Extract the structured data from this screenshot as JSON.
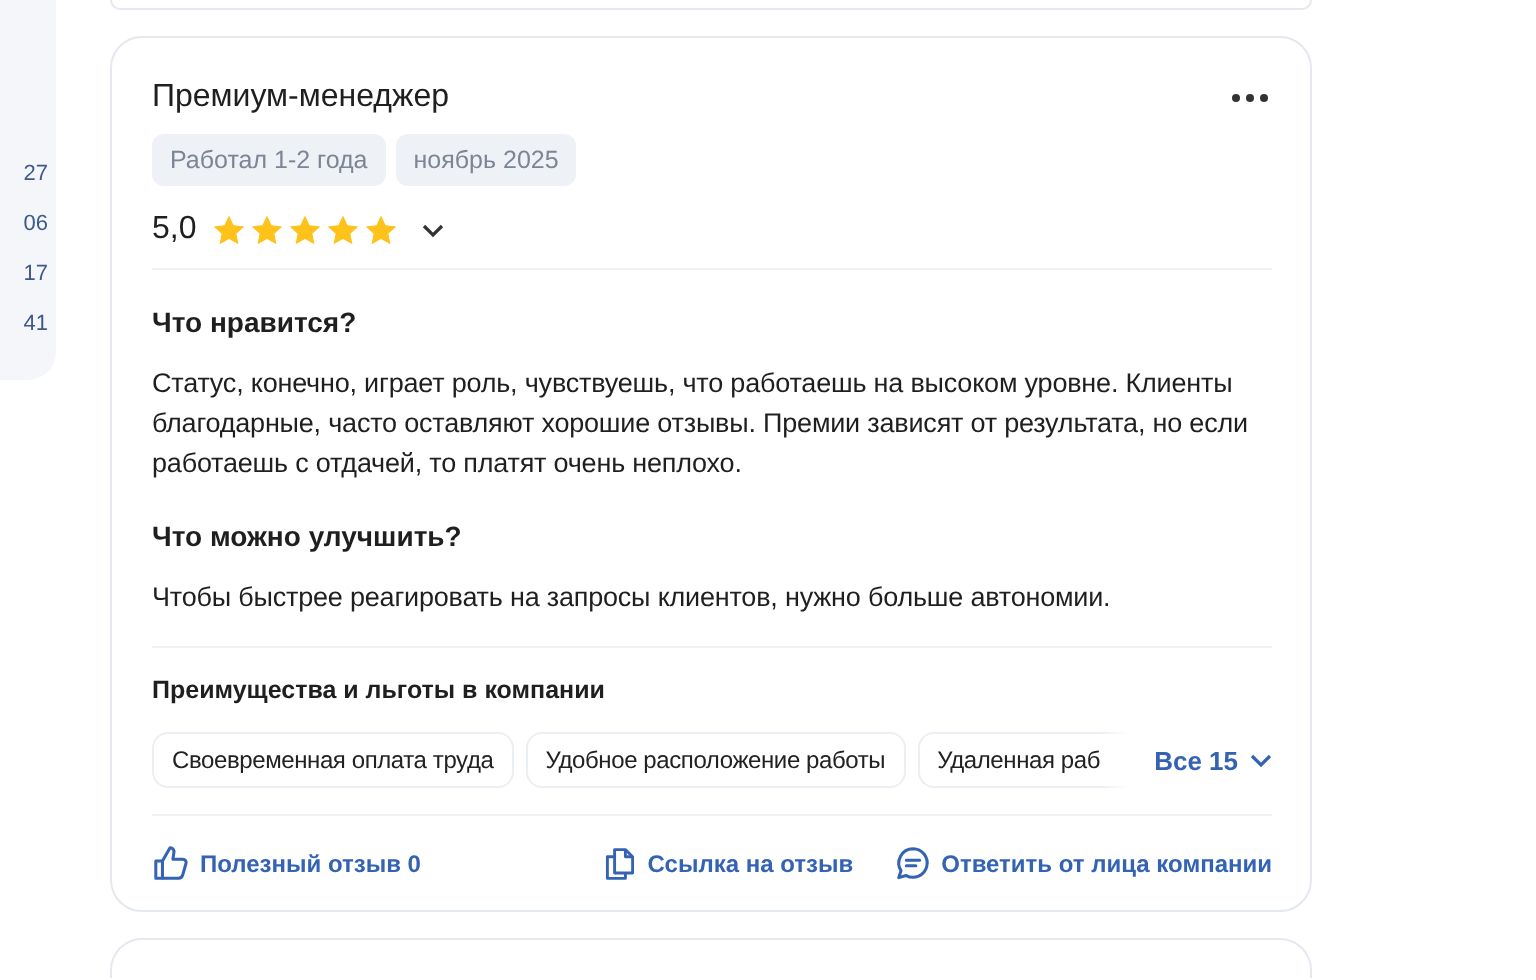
{
  "sidebar": {
    "counts": [
      "27",
      "06",
      "17",
      "41"
    ]
  },
  "review": {
    "title": "Премиум-менеджер",
    "tags": [
      "Работал 1-2 года",
      "ноябрь 2025"
    ],
    "rating": "5,0",
    "stars": 5,
    "sections": [
      {
        "heading": "Что нравится?",
        "text": "Статус, конечно, играет роль, чувствуешь, что работаешь на высоком уровне. Клиенты благодарные, часто оставляют хорошие отзывы. Премии зависят от результата, но если работаешь с отдачей, то платят очень неплохо."
      },
      {
        "heading": "Что можно улучшить?",
        "text": "Чтобы быстрее реагировать на запросы клиентов, нужно больше автономии."
      }
    ],
    "benefits": {
      "heading": "Преимущества и льготы в компании",
      "items": [
        "Своевременная оплата труда",
        "Удобное расположение работы",
        "Удаленная раб"
      ],
      "more": "Все 15"
    },
    "actions": [
      {
        "kind": "like",
        "label": "Полезный отзыв 0"
      },
      {
        "kind": "link",
        "label": "Ссылка на отзыв"
      },
      {
        "kind": "reply",
        "label": "Ответить от лица компании"
      }
    ]
  }
}
